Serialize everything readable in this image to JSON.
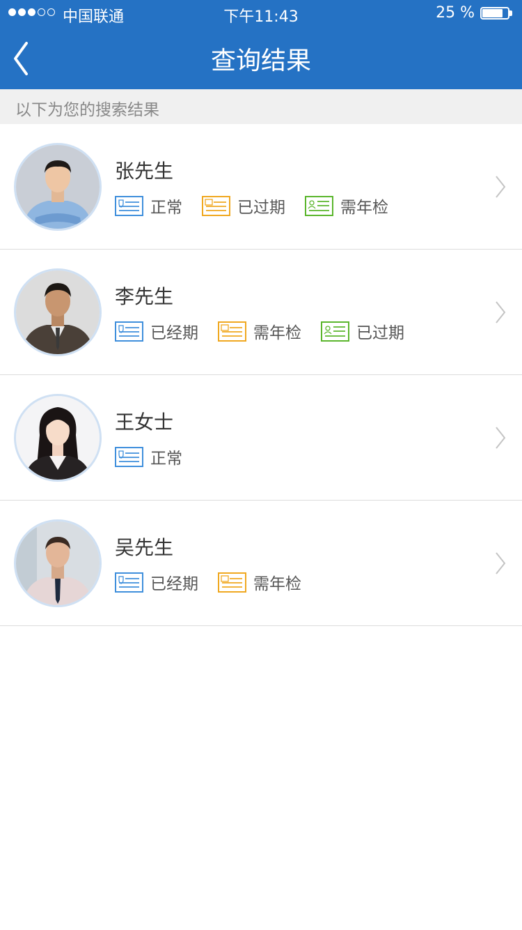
{
  "status_bar": {
    "carrier": "中国联通",
    "time": "下午11:43",
    "battery_percent": "25 %",
    "battery_level": 0.8,
    "signal_bars": 3,
    "signal_total": 5
  },
  "header": {
    "title": "查询结果",
    "color": "#2572c4"
  },
  "subtitle": "以下为您的搜索结果",
  "results": [
    {
      "name": "张先生",
      "badges": [
        {
          "label": "正常",
          "color": "#3f8fdc",
          "icon": "id-card-shield-icon"
        },
        {
          "label": "已过期",
          "color": "#f0a820",
          "icon": "id-card-money-icon"
        },
        {
          "label": "需年检",
          "color": "#5bb62d",
          "icon": "id-card-person-icon"
        }
      ]
    },
    {
      "name": "李先生",
      "badges": [
        {
          "label": "已经期",
          "color": "#3f8fdc",
          "icon": "id-card-shield-icon"
        },
        {
          "label": "需年检",
          "color": "#f0a820",
          "icon": "id-card-money-icon"
        },
        {
          "label": "已过期",
          "color": "#5bb62d",
          "icon": "id-card-person-icon"
        }
      ]
    },
    {
      "name": "王女士",
      "badges": [
        {
          "label": "正常",
          "color": "#3f8fdc",
          "icon": "id-card-shield-icon"
        }
      ]
    },
    {
      "name": "吴先生",
      "badges": [
        {
          "label": "已经期",
          "color": "#3f8fdc",
          "icon": "id-card-shield-icon"
        },
        {
          "label": "需年检",
          "color": "#f0a820",
          "icon": "id-card-money-icon"
        }
      ]
    }
  ]
}
